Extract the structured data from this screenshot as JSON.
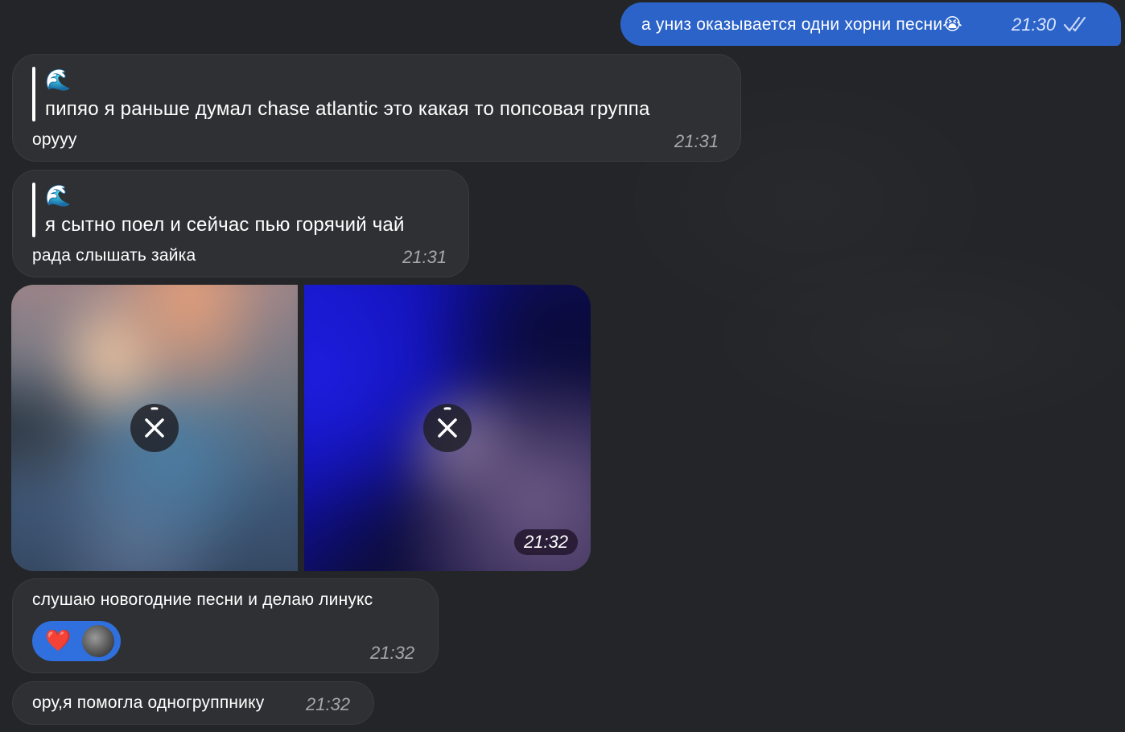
{
  "messages": {
    "m1": {
      "text": "а униз оказывается одни хорни песни😭",
      "time": "21:30",
      "status_icon": "double-check-icon"
    },
    "m2": {
      "quote_emoji": "🌊",
      "quote_text": "пипяо я раньше думал chase atlantic это какая то попсовая группа",
      "text": "оруyy",
      "time": "21:31"
    },
    "m3": {
      "quote_emoji": "🌊",
      "quote_text": "я сытно поел и сейчас пью горячий чай",
      "text": "рада слышать зайка",
      "time": "21:31"
    },
    "m4": {
      "time": "21:32",
      "cancel_icon": "close-icon"
    },
    "m5": {
      "text": "слушаю новогодние песни и делаю линукс",
      "reaction_emoji": "❤️",
      "time": "21:32"
    },
    "m6": {
      "text": "ору,я помогла одногруппнику",
      "time": "21:32"
    }
  },
  "colors": {
    "background": "#242528",
    "incoming_bubble": "#2f3033",
    "outgoing_bubble": "#2b63c9",
    "reaction_pill": "#2f6fde"
  }
}
